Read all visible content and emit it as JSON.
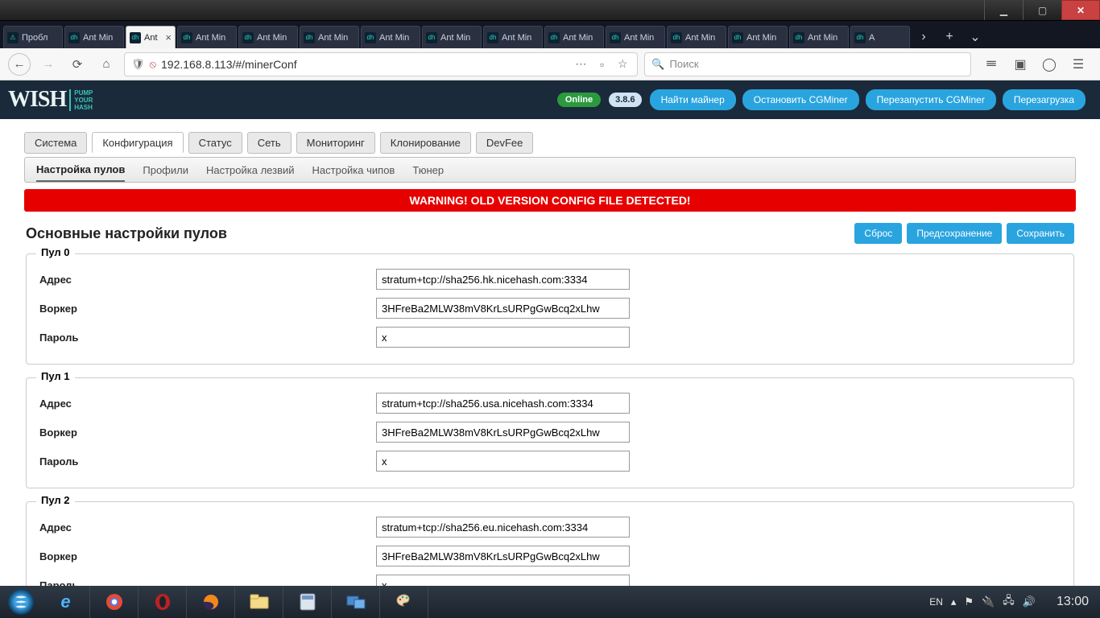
{
  "os_tabs": [
    {
      "label": "Пробл",
      "warn": true
    },
    {
      "label": "Ant Min"
    },
    {
      "label": "Ant",
      "active": true
    },
    {
      "label": "Ant Min"
    },
    {
      "label": "Ant Min"
    },
    {
      "label": "Ant Min"
    },
    {
      "label": "Ant Min"
    },
    {
      "label": "Ant Min"
    },
    {
      "label": "Ant Min"
    },
    {
      "label": "Ant Min"
    },
    {
      "label": "Ant Min"
    },
    {
      "label": "Ant Min"
    },
    {
      "label": "Ant Min"
    },
    {
      "label": "Ant Min"
    },
    {
      "label": "A"
    }
  ],
  "url": "192.168.8.113/#/minerConf",
  "search_placeholder": "Поиск",
  "logo": {
    "main": "WISH",
    "sub1": "PUMP",
    "sub2": "YOUR",
    "sub3": "HASH"
  },
  "status": {
    "online": "Online",
    "version": "3.8.6"
  },
  "header_buttons": [
    "Найти майнер",
    "Остановить CGMiner",
    "Перезапустить CGMiner",
    "Перезагрузка"
  ],
  "tabs1": [
    "Система",
    "Конфигурация",
    "Статус",
    "Сеть",
    "Мониторинг",
    "Клонирование",
    "DevFee"
  ],
  "tabs1_active": 1,
  "tabs2": [
    "Настройка пулов",
    "Профили",
    "Настройка лезвий",
    "Настройка чипов",
    "Тюнер"
  ],
  "tabs2_active": 0,
  "warning": "WARNING! OLD VERSION CONFIG FILE DETECTED!",
  "section_title": "Основные настройки пулов",
  "ctl_buttons": [
    "Сброс",
    "Предсохранение",
    "Сохранить"
  ],
  "labels": {
    "addr": "Адрес",
    "worker": "Воркер",
    "pass": "Пароль"
  },
  "pools": [
    {
      "title": "Пул 0",
      "addr": "stratum+tcp://sha256.hk.nicehash.com:3334",
      "worker": "3HFreBa2MLW38mV8KrLsURPgGwBcq2xLhw",
      "pass": "x"
    },
    {
      "title": "Пул 1",
      "addr": "stratum+tcp://sha256.usa.nicehash.com:3334",
      "worker": "3HFreBa2MLW38mV8KrLsURPgGwBcq2xLhw",
      "pass": "x"
    },
    {
      "title": "Пул 2",
      "addr": "stratum+tcp://sha256.eu.nicehash.com:3334",
      "worker": "3HFreBa2MLW38mV8KrLsURPgGwBcq2xLhw",
      "pass": "x"
    }
  ],
  "tray": {
    "lang": "EN",
    "time": "13:00"
  }
}
